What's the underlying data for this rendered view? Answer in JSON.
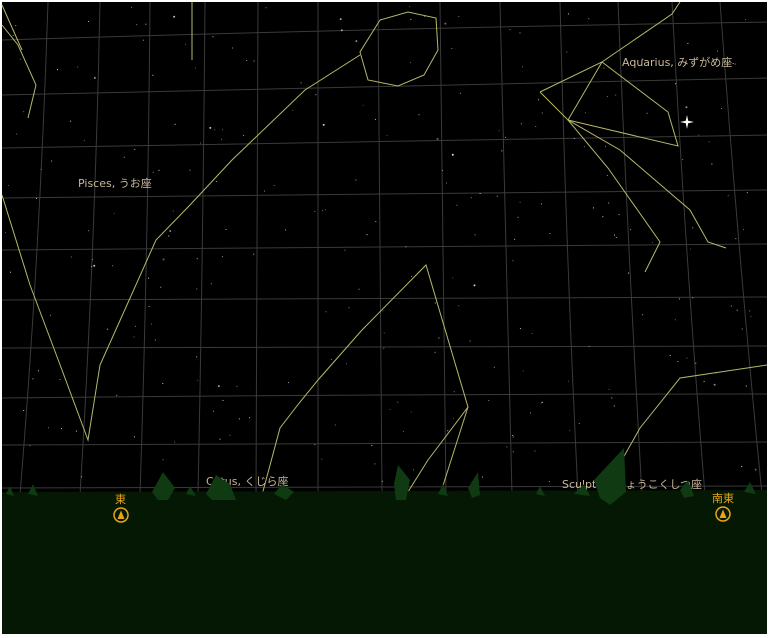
{
  "sky": {
    "background_color": "#000000",
    "grid_color": "#3a3a3a",
    "constellation_line_color": "#b8b86a",
    "label_color": "#c8b89a",
    "ground_color": "#041804",
    "tree_color": "#0f3a12"
  },
  "constellations": [
    {
      "name": "Aquarius, みずがめ座"
    },
    {
      "name": "Pisces, うお座"
    },
    {
      "name": "Cetus, くじら座"
    },
    {
      "name": "Sculptor, ちょうこくしつ座"
    }
  ],
  "directions": [
    {
      "label": "東",
      "icon": "compass-marker-icon",
      "color": "#e8a51a"
    },
    {
      "label": "南東",
      "icon": "compass-marker-icon",
      "color": "#e8a51a"
    }
  ],
  "bright_object": {
    "icon": "sparkle-star-icon"
  }
}
